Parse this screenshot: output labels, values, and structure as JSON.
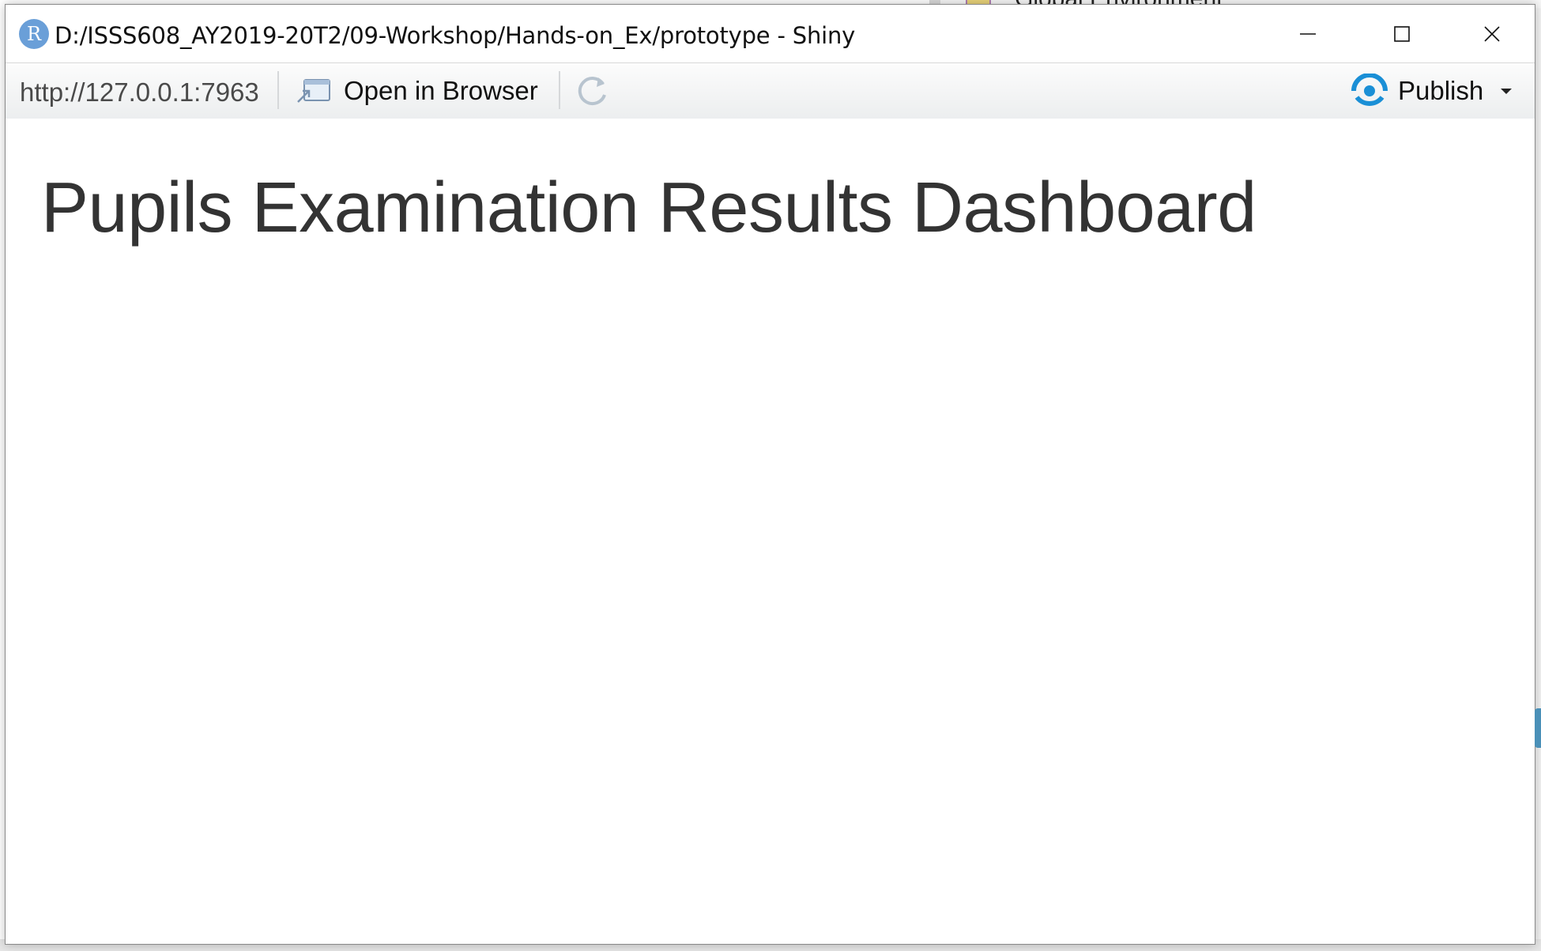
{
  "window": {
    "title": "D:/ISSS608_AY2019-20T2/09-Workshop/Hands-on_Ex/prototype - Shiny",
    "logo_letter": "R"
  },
  "toolbar": {
    "url": "http://127.0.0.1:7963",
    "open_in_browser_label": "Open in Browser",
    "publish_label": "Publish"
  },
  "app": {
    "title": "Pupils Examination Results Dashboard"
  },
  "background": {
    "right_panel_text": "Global Environment"
  },
  "colors": {
    "accent": "#1a8fd6",
    "title_text": "#333333",
    "r_logo": "#6a9fd8"
  }
}
